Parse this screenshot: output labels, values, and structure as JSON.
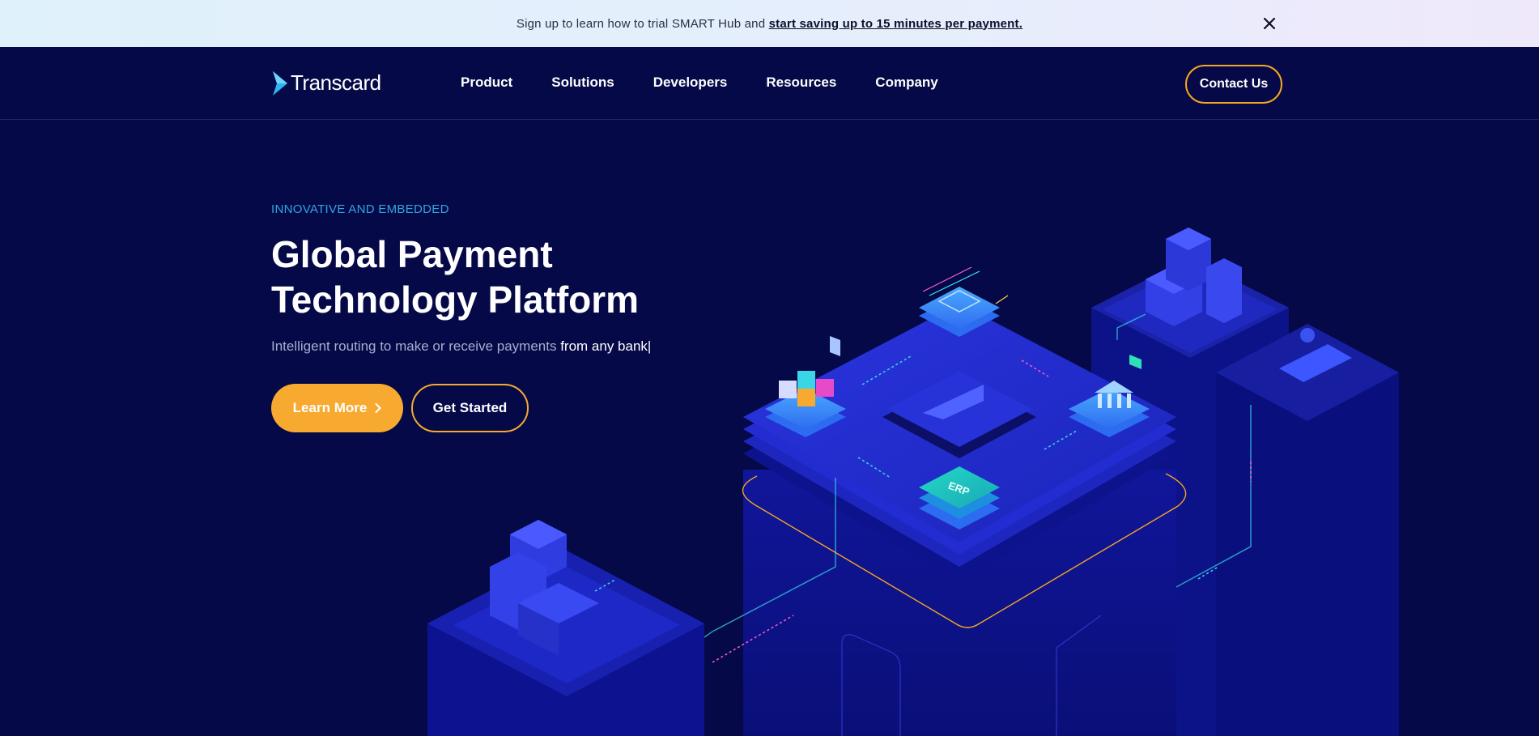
{
  "announcement": {
    "text": "Sign up to learn how to trial SMART Hub and ",
    "link_text": "start saving up to 15 minutes per payment."
  },
  "nav": {
    "brand": "Transcard",
    "items": [
      "Product",
      "Solutions",
      "Developers",
      "Resources",
      "Company"
    ],
    "cta": "Contact Us"
  },
  "hero": {
    "eyebrow": "INNOVATIVE AND EMBEDDED",
    "title_line1": "Global Payment",
    "title_line2": "Technology Platform",
    "subtitle": "Intelligent routing to make or receive payments ",
    "subtitle_highlight": "from any bank|",
    "primary_button": "Learn More",
    "secondary_button": "Get Started",
    "erp_label": "ERP"
  },
  "colors": {
    "background": "#050947",
    "accent": "#f7aa2f",
    "eyebrow": "#2fa6e0"
  }
}
